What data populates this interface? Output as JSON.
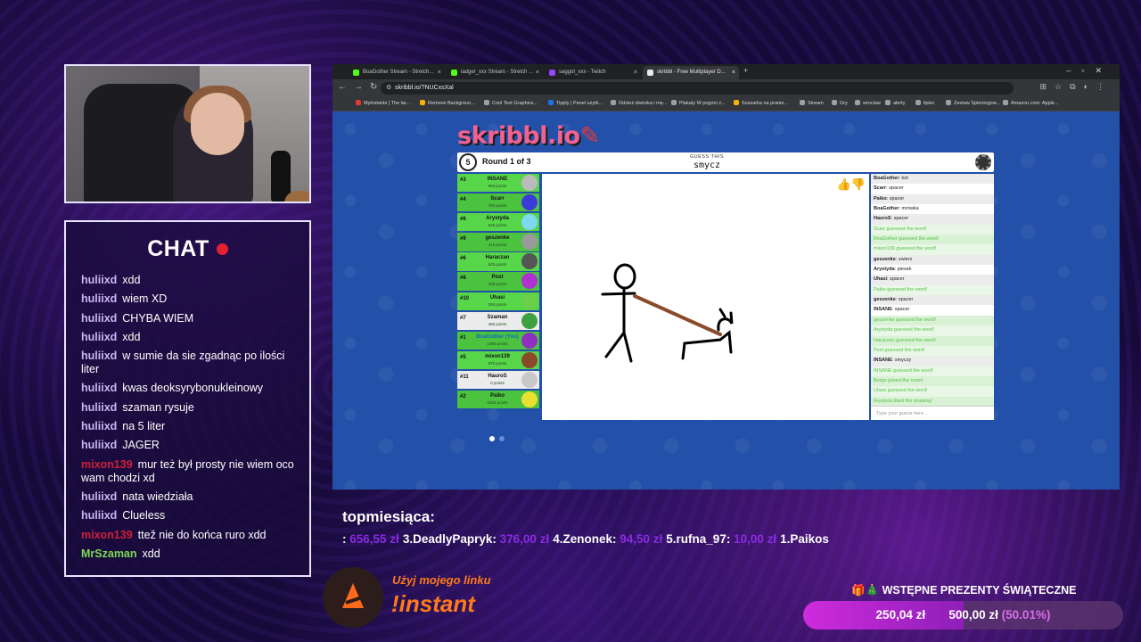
{
  "chat": {
    "title": "CHAT",
    "messages": [
      {
        "user": "huliixd",
        "text": "xdd",
        "color": "#c9b6f2"
      },
      {
        "user": "huliixd",
        "text": "wiem XD",
        "color": "#c9b6f2"
      },
      {
        "user": "huliixd",
        "text": "CHYBA WIEM",
        "color": "#c9b6f2"
      },
      {
        "user": "huliixd",
        "text": "xdd",
        "color": "#c9b6f2"
      },
      {
        "user": "huliixd",
        "text": "w sumie da sie zgadnąc po ilości liter",
        "color": "#c9b6f2"
      },
      {
        "user": "huliixd",
        "text": "kwas deoksyrybonukleinowy",
        "color": "#c9b6f2"
      },
      {
        "user": "huliixd",
        "text": "szaman rysuje",
        "color": "#c9b6f2"
      },
      {
        "user": "huliixd",
        "text": "na 5 liter",
        "color": "#c9b6f2"
      },
      {
        "user": "huliixd",
        "text": "JAGER",
        "color": "#c9b6f2"
      },
      {
        "user": "mixon139",
        "text": "mur też był prosty nie wiem oco wam chodzi xd",
        "color": "#d01e3a"
      },
      {
        "user": "huliixd",
        "text": "nata wiedziała",
        "color": "#c9b6f2"
      },
      {
        "user": "huliixd",
        "text": "Clueless",
        "color": "#c9b6f2"
      },
      {
        "user": "mixon139",
        "text": "ttež nie do końca ruro xdd",
        "color": "#d01e3a"
      },
      {
        "user": "MrSzaman",
        "text": "xdd",
        "color": "#7ed957"
      }
    ]
  },
  "browser": {
    "tabs": [
      {
        "label": "BoaGother Stream - Stretch...",
        "active": false,
        "icon_color": "#53fc18"
      },
      {
        "label": "ladger_xxx Stream - Stretch ...",
        "active": false,
        "icon_color": "#53fc18"
      },
      {
        "label": "saggot_xxx - Twitch",
        "active": false,
        "icon_color": "#9146ff"
      },
      {
        "label": "skribbl - Free Multiplayer D...",
        "active": true,
        "icon_color": "#e8eaed"
      }
    ],
    "url": "skribbl.io/?NUCxsXal",
    "bookmarks": [
      {
        "label": "Myinstants | The lar...",
        "color": "#e53935"
      },
      {
        "label": "Remove Backgroun...",
        "color": "#f4b400"
      },
      {
        "label": "Cool Text Graphics...",
        "color": "#9aa0a6"
      },
      {
        "label": "Tipply | Panel użytk...",
        "color": "#1a73e8"
      },
      {
        "label": "Odzież damska i mę...",
        "color": "#9aa0a6"
      },
      {
        "label": "Plakaty W pogoni z...",
        "color": "#9aa0a6"
      },
      {
        "label": "Suszarka na pranie...",
        "color": "#f4b400"
      },
      {
        "label": "Stream",
        "color": "#9aa0a6"
      },
      {
        "label": "Gry",
        "color": "#9aa0a6"
      },
      {
        "label": "wroclaw",
        "color": "#9aa0a6"
      },
      {
        "label": "alerty",
        "color": "#9aa0a6"
      },
      {
        "label": "lipiec",
        "color": "#9aa0a6"
      },
      {
        "label": "Zestaw Spinningow...",
        "color": "#9aa0a6"
      },
      {
        "label": "Amazon.com: Apple...",
        "color": "#9aa0a6"
      }
    ]
  },
  "game": {
    "logo": "skribbl.io",
    "round_number": "5",
    "round_text": "Round 1 of 3",
    "guess_label": "GUESS THIS",
    "guess_word": "smycz",
    "players": [
      {
        "rank": "#3",
        "name": "INSANE",
        "points": "965 points",
        "name_color": "#111",
        "avatar": "#bbbbbb",
        "bg": "green"
      },
      {
        "rank": "#4",
        "name": "Scarr",
        "points": "780 points",
        "name_color": "#111",
        "avatar": "#3b3bd9",
        "bg": "alt"
      },
      {
        "rank": "#6",
        "name": "Arystyda",
        "points": "625 points",
        "name_color": "#111",
        "avatar": "#7fd8f0",
        "bg": "green"
      },
      {
        "rank": "#9",
        "name": "geszenke",
        "points": "215 points",
        "name_color": "#111",
        "avatar": "#9a9a9a",
        "bg": "alt"
      },
      {
        "rank": "#6",
        "name": "Haraczan",
        "points": "625 points",
        "name_color": "#111",
        "avatar": "#555555",
        "bg": "green"
      },
      {
        "rank": "#8",
        "name": "Post",
        "points": "335 points",
        "name_color": "#111",
        "avatar": "#b030d0",
        "bg": "alt"
      },
      {
        "rank": "#10",
        "name": "Uhasi",
        "points": "200 points",
        "name_color": "#111",
        "avatar": "#6ad04a",
        "bg": "green"
      },
      {
        "rank": "#7",
        "name": "Szaman",
        "points": "450 points",
        "name_color": "#111",
        "avatar": "#3ea03e",
        "bg": "white"
      },
      {
        "rank": "#1",
        "name": "BoaGother (You)",
        "points": "1090 points",
        "name_color": "#1565c0",
        "avatar": "#9030c0",
        "bg": "alt"
      },
      {
        "rank": "#5",
        "name": "mixon139",
        "points": "670 points",
        "name_color": "#111",
        "avatar": "#8a4a2a",
        "bg": "green"
      },
      {
        "rank": "#11",
        "name": "HauroS",
        "points": "0 points",
        "name_color": "#111",
        "avatar": "#c8c8c8",
        "bg": "white"
      },
      {
        "rank": "#2",
        "name": "Paiko",
        "points": "1025 points",
        "name_color": "#111",
        "avatar": "#e8e030",
        "bg": "alt"
      }
    ],
    "messages": [
      {
        "user": "BoaGother",
        "text": "kot",
        "correct": false
      },
      {
        "user": "Scarr",
        "text": "spacer",
        "correct": false
      },
      {
        "user": "Paiko",
        "text": "spacer",
        "correct": false
      },
      {
        "user": "BoaGother",
        "text": "mrówka",
        "correct": false
      },
      {
        "user": "HauroS",
        "text": "spacer",
        "correct": false
      },
      {
        "user": "",
        "text": "Scarr guessed the word!",
        "correct": true
      },
      {
        "user": "",
        "text": "BoaGother guessed the word!",
        "correct": true
      },
      {
        "user": "",
        "text": "mixon139 guessed the word!",
        "correct": true
      },
      {
        "user": "geszenke",
        "text": "zwierz",
        "correct": false
      },
      {
        "user": "Arystyda",
        "text": "piesek",
        "correct": false
      },
      {
        "user": "Uhasi",
        "text": "spacer",
        "correct": false
      },
      {
        "user": "",
        "text": "Paiko guessed the word!",
        "correct": true
      },
      {
        "user": "geszenke",
        "text": "spacer",
        "correct": false
      },
      {
        "user": "INSANE",
        "text": "spacer",
        "correct": false
      },
      {
        "user": "",
        "text": "geszenke guessed the word!",
        "correct": true
      },
      {
        "user": "",
        "text": "Arystyda guessed the word!",
        "correct": true
      },
      {
        "user": "",
        "text": "Haraczan guessed the word!",
        "correct": true
      },
      {
        "user": "",
        "text": "Post guessed the word!",
        "correct": true
      },
      {
        "user": "INSANE",
        "text": "smyczy",
        "correct": false
      },
      {
        "user": "",
        "text": "INSANE guessed the word!",
        "correct": true
      },
      {
        "user": "",
        "text": "Borgo joined the room!",
        "correct": true
      },
      {
        "user": "",
        "text": "Uhasi guessed the word!",
        "correct": true
      },
      {
        "user": "",
        "text": "Arystyda liked the drawing!",
        "correct": true
      }
    ],
    "input_placeholder": "Type your guess here..."
  },
  "leaderboard": {
    "title": "topmiesiąca:",
    "prefix": ":",
    "entries": [
      {
        "rank": "",
        "name": "",
        "amount": "656,55 zł"
      },
      {
        "rank": "3.",
        "name": "DeadlyPapryk:",
        "amount": "376,00 zł"
      },
      {
        "rank": "4.",
        "name": "Zenonek:",
        "amount": "94,50 zł"
      },
      {
        "rank": "5.",
        "name": "rufna_97:",
        "amount": "10,00 zł"
      },
      {
        "rank": "1.",
        "name": "Paikos",
        "amount": ""
      }
    ]
  },
  "promo": {
    "line1": "Użyj mojego linku",
    "line2": "!instant"
  },
  "goal": {
    "title": "🎁🎄 WSTĘPNE PREZENTY ŚWIĄTECZNE",
    "current": "250,04 zł",
    "target": "500,00 zł",
    "percent_label": "(50.01%)",
    "progress_percent": 50.01
  }
}
